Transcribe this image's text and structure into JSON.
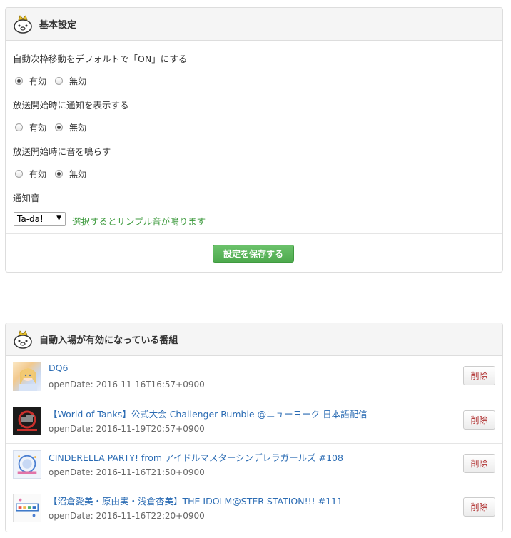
{
  "settings_panel": {
    "title": "基本設定",
    "auto_move": {
      "label": "自動次枠移動をデフォルトで「ON」にする",
      "options": [
        "有効",
        "無効"
      ],
      "selected": "有効"
    },
    "notify_show": {
      "label": "放送開始時に通知を表示する",
      "options": [
        "有効",
        "無効"
      ],
      "selected": "無効"
    },
    "notify_sound": {
      "label": "放送開始時に音を鳴らす",
      "options": [
        "有効",
        "無効"
      ],
      "selected": "無効"
    },
    "sound_select": {
      "label": "通知音",
      "value": "Ta-da!",
      "help": "選択するとサンプル音が鳴ります"
    },
    "save_label": "設定を保存する"
  },
  "programs_panel": {
    "title": "自動入場が有効になっている番組",
    "delete_label": "削除",
    "items": [
      {
        "title": "DQ6",
        "open_date": "openDate: 2016-11-16T16:57+0900",
        "thumb_icon": "anime-girl-thumbnail"
      },
      {
        "title": "【World of Tanks】公式大会 Challenger Rumble @ニューヨーク 日本語配信",
        "open_date": "openDate: 2016-11-19T20:57+0900",
        "thumb_icon": "tank-game-thumbnail"
      },
      {
        "title": "CINDERELLA PARTY! from アイドルマスターシンデレラガールズ #108",
        "open_date": "openDate: 2016-11-16T21:50+0900",
        "thumb_icon": "cinderella-party-thumbnail"
      },
      {
        "title": "【沼倉愛美・原由実・浅倉杏美】THE IDOLM@STER STATION!!! #111",
        "open_date": "openDate: 2016-11-16T22:20+0900",
        "thumb_icon": "idolmaster-station-thumbnail"
      }
    ]
  },
  "colors": {
    "accent_green": "#5cb85c",
    "link_blue": "#2a6bb3",
    "delete_red": "#b03030",
    "help_green": "#3c9a3c"
  }
}
